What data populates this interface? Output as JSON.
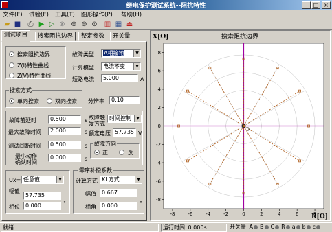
{
  "window": {
    "title": "继电保护测试系统--阻抗特性",
    "min_icon": "minimize-icon",
    "max_icon": "maximize-icon",
    "close_icon": "close-icon"
  },
  "menu": [
    "文件(F)",
    "试验(E)",
    "工具(T)",
    "图形操作(P)",
    "帮助(H)"
  ],
  "toolbar_icons": [
    "open-folder-icon",
    "save-icon",
    "print-icon",
    "start-icon",
    "step-icon",
    "stop-icon",
    "zoom-in-icon",
    "zoom-out-icon",
    "zoom-fit-icon",
    "chart-icon",
    "settings-icon",
    "exit-icon"
  ],
  "tabs": [
    "测试项目",
    "搜索阻抗边界",
    "整定参数",
    "开关量"
  ],
  "test_items": {
    "options": [
      "搜索阻抗边界",
      "Z(I)特性曲线",
      "Z(V)特性曲线"
    ],
    "selected": 0
  },
  "fault": {
    "type_label": "故障类型",
    "type_value": "A相接地",
    "model_label": "计算模型",
    "model_value": "电流不变",
    "current_label": "短路电流",
    "current_value": "5.000",
    "current_unit": "A"
  },
  "search": {
    "group_label": "搜索方式",
    "options": [
      "单向搜索",
      "双向搜索"
    ],
    "selected": 0,
    "resolution_label": "分辨率",
    "resolution_value": "0.10"
  },
  "timing": {
    "pre_fault_label": "故障前延时",
    "pre_fault_value": "0.500",
    "pre_fault_unit": "s",
    "max_fault_label": "最大故障时间",
    "max_fault_value": "2.000",
    "max_fault_unit": "s",
    "interval_label": "测试间断时间",
    "interval_value": "0.500",
    "interval_unit": "s",
    "min_action_label1": "最小动作",
    "min_action_label2": "确认时间",
    "min_action_value": "0.000",
    "min_action_unit": "s"
  },
  "trigger": {
    "label1": "故障触",
    "label2": "发方式",
    "value": "时间控制",
    "rated_voltage_label": "额定电压",
    "rated_voltage_value": "57.735",
    "rated_voltage_unit": "V",
    "direction_label": "故障方向",
    "direction_options": [
      "正",
      "反"
    ],
    "direction_selected": 0
  },
  "ux": {
    "label": "Ux=",
    "value": "任意值",
    "amp_label": "幅值",
    "amp_value": "57.735",
    "phase_label": "相位",
    "phase_value": "0.000",
    "phase_unit": "°"
  },
  "zero_seq": {
    "group_label": "零序补偿系数",
    "method_label": "计算方式",
    "method_value": "KL方式",
    "amp_label": "幅值",
    "amp_value": "0.667",
    "angle_label": "相角",
    "angle_value": "0.000",
    "angle_unit": "°"
  },
  "chart_data": {
    "type": "scatter",
    "title": "搜索阻抗边界",
    "ylabel": "X[Ω]",
    "xlabel": "R[Ω]",
    "xlim": [
      -9,
      9
    ],
    "ylim": [
      -9,
      9
    ],
    "x_ticks": [
      -8,
      -6,
      -4,
      -2,
      0,
      2,
      4,
      6,
      8
    ],
    "y_ticks": [
      -8,
      -6,
      -4,
      -2,
      0,
      2,
      4,
      6,
      8
    ],
    "origin_label": "0",
    "grid": "polar circles and radial lines",
    "center": [
      0,
      0
    ],
    "series": [
      {
        "values": [
          [
            0,
            7.3
          ],
          [
            3.8,
            6.3
          ],
          [
            6.3,
            3.8
          ],
          [
            7.3,
            0
          ],
          [
            6.3,
            -3.8
          ],
          [
            3.8,
            -6.3
          ],
          [
            0,
            -7.3
          ],
          [
            -3.8,
            -6.3
          ],
          [
            -6.3,
            -3.8
          ],
          [
            -7.3,
            0
          ],
          [
            -6.3,
            3.8
          ],
          [
            -3.8,
            6.3
          ]
        ]
      }
    ],
    "colors": {
      "axes": "#a000a0",
      "lines": "#b06020",
      "points": "#b06020",
      "grid": "#c0c0c0",
      "center": "#000000"
    }
  },
  "status": {
    "ready": "就绪",
    "runtime_label": "运行时间",
    "runtime_value": "0.000s",
    "switch_label": "开关量",
    "switches": [
      "A",
      "B",
      "C",
      "R",
      "a",
      "b",
      "c"
    ]
  }
}
